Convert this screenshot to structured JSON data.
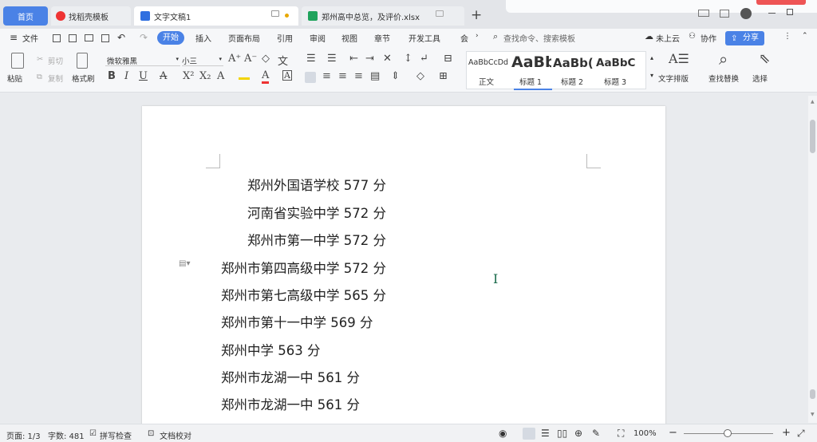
{
  "tabs": {
    "home": "首页",
    "daoke": "找稻壳模板",
    "doc": "文字文稿1",
    "xls": "郑州高中总览，及评价.xlsx"
  },
  "menu": {
    "file": "文件",
    "start": "开始",
    "insert": "插入",
    "layout": "页面布局",
    "ref": "引用",
    "review": "审阅",
    "view": "视图",
    "chapter": "章节",
    "dev": "开发工具",
    "member": "会",
    "search": "查找命令、搜索模板",
    "cloud": "未上云",
    "collab": "协作",
    "share": "分享"
  },
  "ribbon": {
    "paste": "粘贴",
    "cut": "剪切",
    "copy": "复制",
    "format_painter": "格式刷",
    "font": "微软雅黑",
    "size": "小三",
    "styles": [
      {
        "preview": "AaBbCcDd",
        "label": "正文"
      },
      {
        "preview": "AaBb",
        "label": "标题 1"
      },
      {
        "preview": "AaBb(",
        "label": "标题 2"
      },
      {
        "preview": "AaBbC",
        "label": "标题 3"
      }
    ],
    "text_layout": "文字排版",
    "find_replace": "查找替换",
    "select": "选择"
  },
  "lines": [
    "郑州外国语学校  577 分",
    "河南省实验中学  572 分",
    "郑州市第一中学  572 分",
    "郑州市第四高级中学  572 分",
    "郑州市第七高级中学  565 分",
    "郑州市第十一中学  569 分",
    "郑州中学  563 分",
    "郑州市龙湖一中  561 分",
    "郑州市龙湖一中  561 分"
  ],
  "status": {
    "page": "页面: 1/3",
    "words": "字数: 481",
    "spell": "拼写检查",
    "proof": "文档校对",
    "zoom": "100%"
  }
}
